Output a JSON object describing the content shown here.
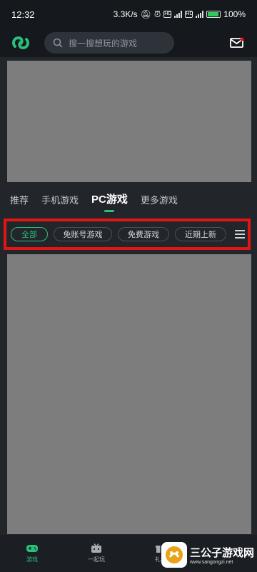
{
  "status_bar": {
    "time": "12:32",
    "speed": "3.3K/s",
    "battery_percent": "100%",
    "hd_label": "HD",
    "network_label": "4G"
  },
  "header": {
    "search_placeholder": "搜一搜想玩的游戏"
  },
  "tabs": [
    {
      "label": "推荐"
    },
    {
      "label": "手机游戏"
    },
    {
      "label": "PC游戏"
    },
    {
      "label": "更多游戏"
    }
  ],
  "filters": [
    {
      "label": "全部"
    },
    {
      "label": "免账号游戏"
    },
    {
      "label": "免费游戏"
    },
    {
      "label": "近期上新"
    }
  ],
  "bottom_nav": [
    {
      "label": "游戏"
    },
    {
      "label": "一起玩"
    },
    {
      "label": "礼包"
    }
  ],
  "watermark": {
    "title": "三公子游戏网",
    "url": "www.sangongzi.net"
  },
  "colors": {
    "accent": "#27c07d",
    "highlight_box": "#e21515"
  }
}
